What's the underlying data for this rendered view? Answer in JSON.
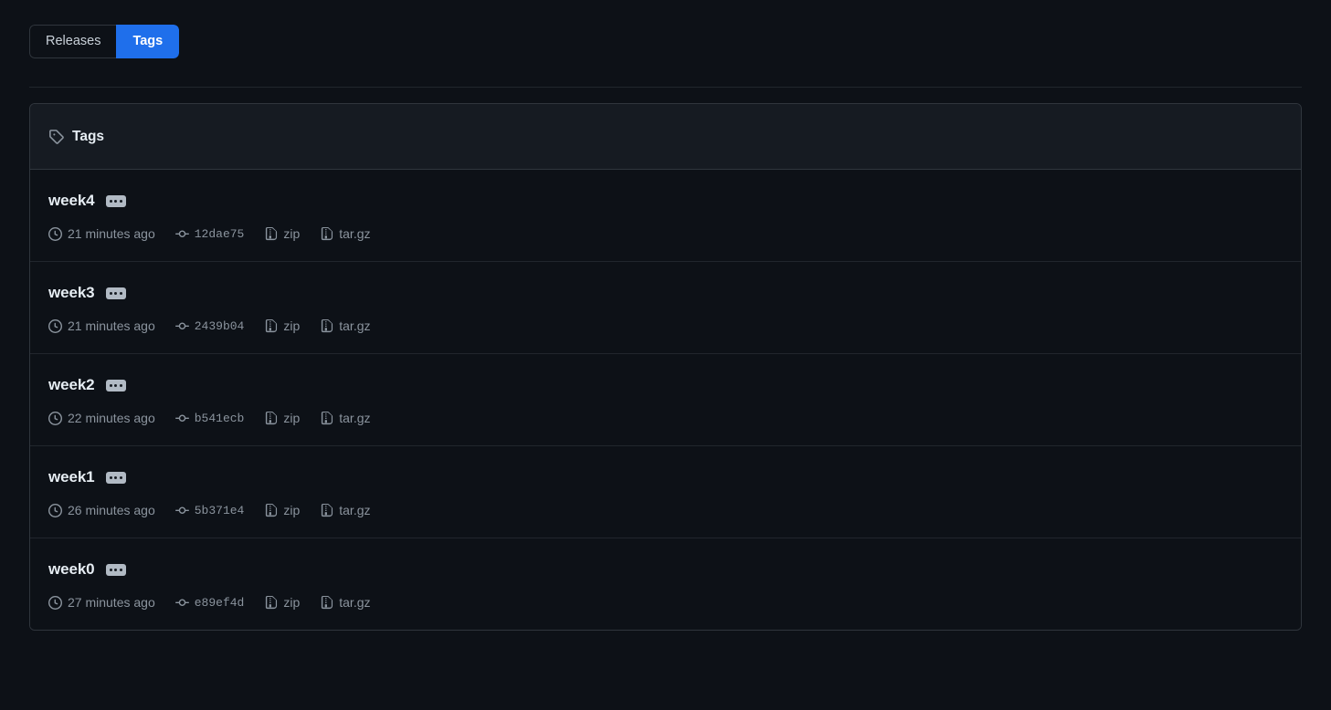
{
  "toggle": {
    "releases_label": "Releases",
    "tags_label": "Tags",
    "active": "Tags",
    "active_color": "#1f6feb"
  },
  "panel": {
    "header_title": "Tags",
    "header_icon": "tag-icon"
  },
  "tags": [
    {
      "name": "week4",
      "time": "21 minutes ago",
      "commit": "12dae75",
      "zip_label": "zip",
      "targz_label": "tar.gz"
    },
    {
      "name": "week3",
      "time": "21 minutes ago",
      "commit": "2439b04",
      "zip_label": "zip",
      "targz_label": "tar.gz"
    },
    {
      "name": "week2",
      "time": "22 minutes ago",
      "commit": "b541ecb",
      "zip_label": "zip",
      "targz_label": "tar.gz"
    },
    {
      "name": "week1",
      "time": "26 minutes ago",
      "commit": "5b371e4",
      "zip_label": "zip",
      "targz_label": "tar.gz"
    },
    {
      "name": "week0",
      "time": "27 minutes ago",
      "commit": "e89ef4d",
      "zip_label": "zip",
      "targz_label": "tar.gz"
    }
  ],
  "colors": {
    "page_background": "#0d1117",
    "panel_header_background": "#161b22",
    "border": "#30363d",
    "text_primary": "#e6edf3",
    "text_muted": "#8b949e",
    "accent": "#1f6feb"
  }
}
